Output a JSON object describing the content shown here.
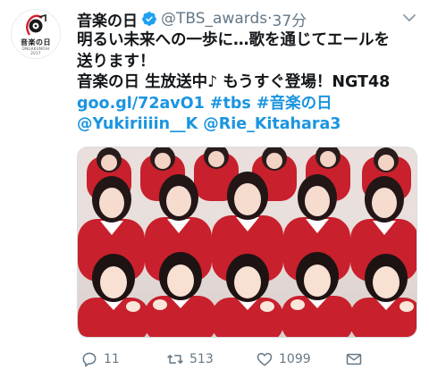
{
  "tweet": {
    "display_name": "音楽の日",
    "handle": "@TBS_awards",
    "separator": "·",
    "time": "37分",
    "verified": true,
    "avatar": {
      "logo_title": "音楽の日",
      "logo_sub": "ONGAKUNOHI",
      "logo_year": "2017"
    },
    "text_lines": [
      "明るい未来への一歩に…歌を通じてエールを",
      "送ります！",
      "音楽の日 生放送中♪ もうすぐ登場！NGT48"
    ],
    "link_line_1": "goo.gl/72avO1 #tbs #音楽の日",
    "link_line_2": "@Yukiriiiin__K @Rie_Kitahara3",
    "media_icon": "group-photo-image"
  },
  "actions": {
    "reply_count": "11",
    "retweet_count": "513",
    "like_count": "1099"
  },
  "colors": {
    "link": "#1b95e0",
    "muted": "#657786",
    "verified": "#1da1f2",
    "uniform_red": "#c8202c"
  }
}
